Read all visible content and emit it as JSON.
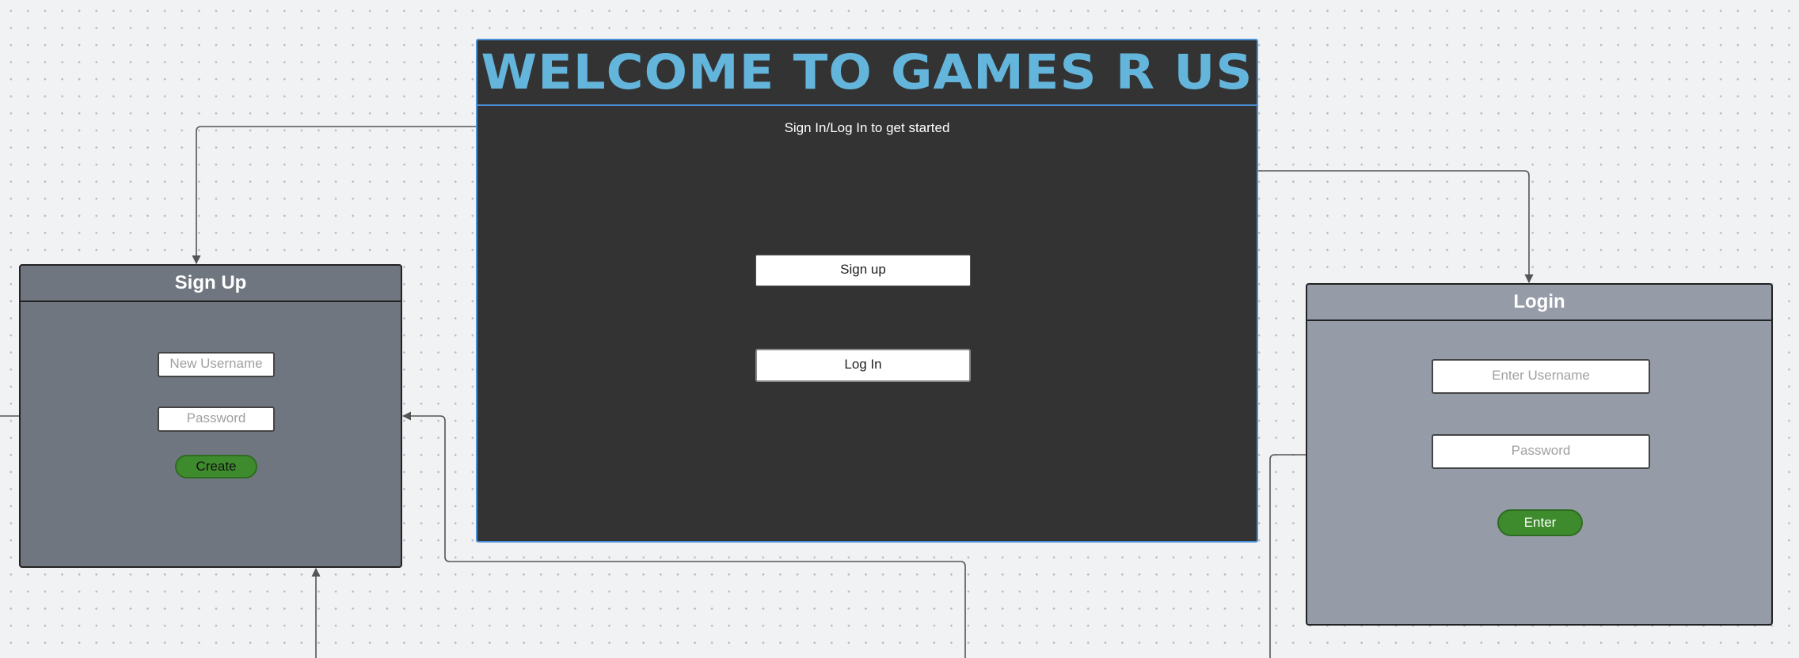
{
  "welcome": {
    "title": "WELCOME TO GAMES R US",
    "subtitle": "Sign In/Log In to get started",
    "signup_button": "Sign up",
    "login_button": "Log In"
  },
  "signup": {
    "title": "Sign Up",
    "username_placeholder": "New Username",
    "password_placeholder": "Password",
    "create_button": "Create"
  },
  "login": {
    "title": "Login",
    "username_placeholder": "Enter Username",
    "password_placeholder": "Password",
    "enter_button": "Enter"
  },
  "colors": {
    "canvas": "#f1f2f4",
    "welcome_bg": "#333333",
    "welcome_accent": "#4a90d9",
    "title_color": "#64b5dc",
    "signup_bg": "#6f7680",
    "login_bg": "#969ca7",
    "button_green": "#3e8b2d",
    "connector": "#555555"
  }
}
